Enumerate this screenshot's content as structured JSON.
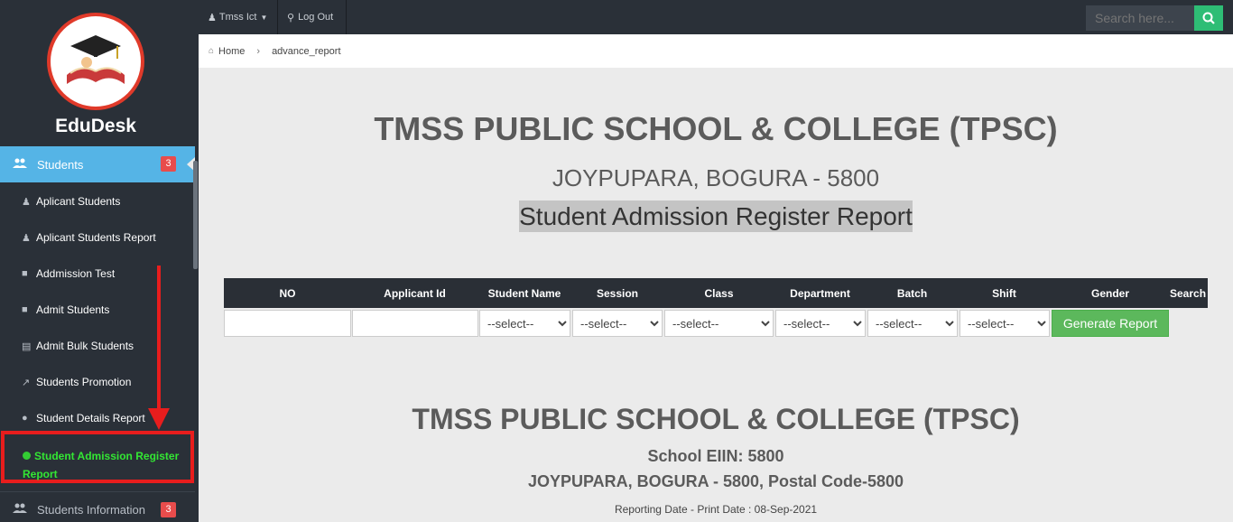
{
  "sidebar": {
    "brand": "EduDesk",
    "active_section": {
      "label": "Students",
      "badge": "3"
    },
    "items": [
      {
        "label": "Aplicant Students"
      },
      {
        "label": "Aplicant Students Report"
      },
      {
        "label": "Addmission Test"
      },
      {
        "label": "Admit Students"
      },
      {
        "label": "Admit Bulk Students"
      },
      {
        "label": "Students Promotion"
      },
      {
        "label": "Student Details Report"
      }
    ],
    "current_item": {
      "label": "Student Admission Register Report"
    },
    "next_section": {
      "label": "Students Information",
      "badge": "3"
    }
  },
  "topbar": {
    "user_label": "Tmss Ict",
    "logout_label": "Log Out",
    "search_placeholder": "Search here..."
  },
  "breadcrumb": {
    "home": "Home",
    "current": "advance_report"
  },
  "header": {
    "school_name": "TMSS PUBLIC SCHOOL & COLLEGE (TPSC)",
    "address": "JOYPUPARA, BOGURA - 5800",
    "report_title": "Student Admission Register Report"
  },
  "filter_table": {
    "columns": [
      "NO",
      "Applicant Id",
      "Student Name",
      "Session",
      "Class",
      "Department",
      "Batch",
      "Shift",
      "Gender",
      "Search"
    ],
    "select_placeholder": "--select--",
    "generate_label": "Generate Report"
  },
  "report": {
    "school_name": "TMSS PUBLIC SCHOOL & COLLEGE (TPSC)",
    "eiin": "School EIIN: 5800",
    "address": "JOYPUPARA, BOGURA - 5800, Postal Code-5800",
    "date_line": "Reporting Date - Print Date : 08-Sep-2021"
  },
  "colors": {
    "accent": "#55b4e6",
    "alert": "#e81d1d",
    "success": "#5cb85c",
    "sidebar": "#2a3038"
  }
}
